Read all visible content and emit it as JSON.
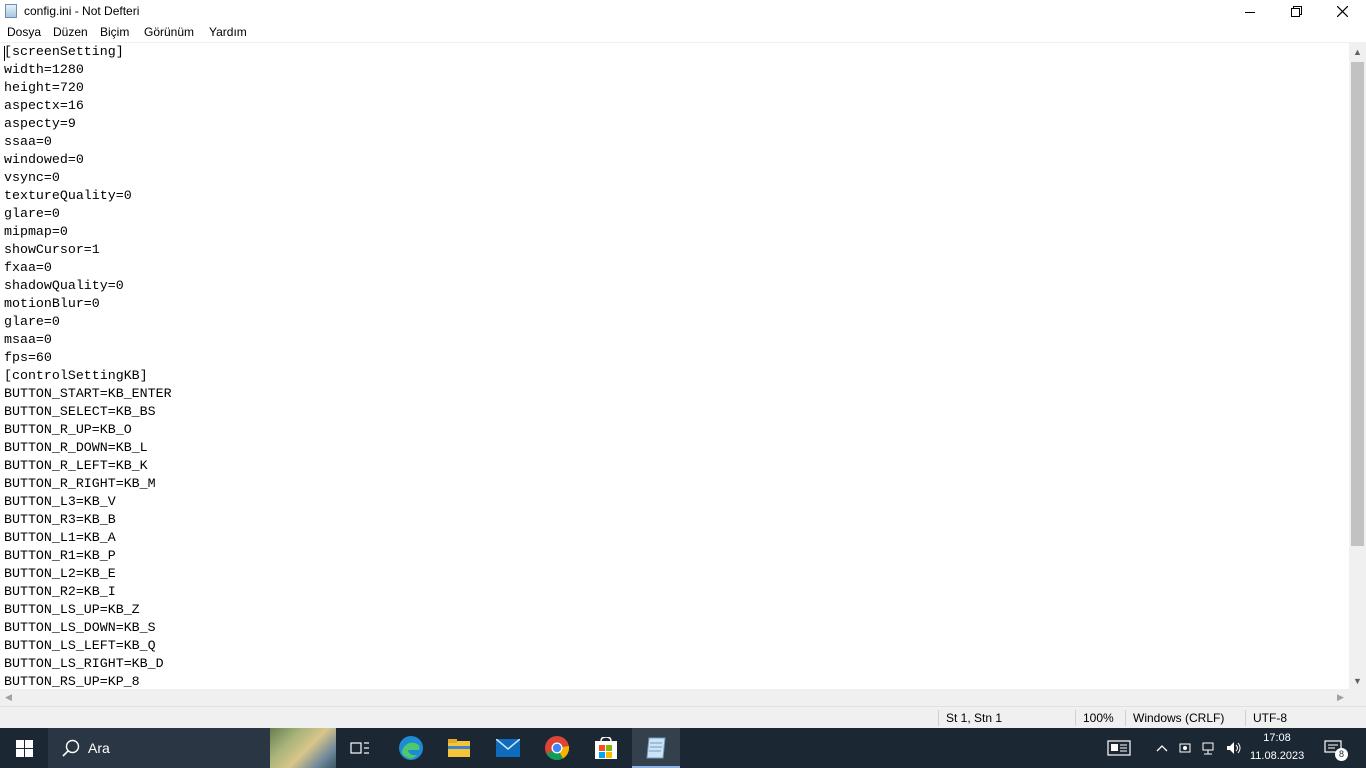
{
  "window": {
    "title": "config.ini - Not Defteri",
    "controls": [
      "minimize-icon",
      "restore-icon",
      "close-icon"
    ]
  },
  "menu": [
    "Dosya",
    "Düzen",
    "Biçim",
    "Görünüm",
    "Yardım"
  ],
  "editor": {
    "lines": [
      "[screenSetting]",
      "width=1280",
      "height=720",
      "aspectx=16",
      "aspecty=9",
      "ssaa=0",
      "windowed=0",
      "vsync=0",
      "textureQuality=0",
      "glare=0",
      "mipmap=0",
      "showCursor=1",
      "fxaa=0",
      "shadowQuality=0",
      "motionBlur=0",
      "glare=0",
      "msaa=0",
      "fps=60",
      "[controlSettingKB]",
      "BUTTON_START=KB_ENTER",
      "BUTTON_SELECT=KB_BS",
      "BUTTON_R_UP=KB_O",
      "BUTTON_R_DOWN=KB_L",
      "BUTTON_R_LEFT=KB_K",
      "BUTTON_R_RIGHT=KB_M",
      "BUTTON_L3=KB_V",
      "BUTTON_R3=KB_B",
      "BUTTON_L1=KB_A",
      "BUTTON_R1=KB_P",
      "BUTTON_L2=KB_E",
      "BUTTON_R2=KB_I",
      "BUTTON_LS_UP=KB_Z",
      "BUTTON_LS_DOWN=KB_S",
      "BUTTON_LS_LEFT=KB_Q",
      "BUTTON_LS_RIGHT=KB_D",
      "BUTTON_RS_UP=KP_8"
    ]
  },
  "status": {
    "position": "St 1, Stn 1",
    "zoom": "100%",
    "line_ending": "Windows (CRLF)",
    "encoding": "UTF-8"
  },
  "taskbar": {
    "search_label": "Ara",
    "time": "17:08",
    "date": "11.08.2023",
    "notification_count": "8",
    "pinned_icons": [
      "task-view-icon",
      "edge-icon",
      "file-explorer-icon",
      "mail-icon",
      "chrome-icon",
      "store-icon",
      "notepad-icon"
    ]
  },
  "colors": {
    "taskbar_bg": "#1c2734",
    "scrollbar_bg": "#f0f0f0",
    "scroll_thumb": "#c2c2c2"
  }
}
